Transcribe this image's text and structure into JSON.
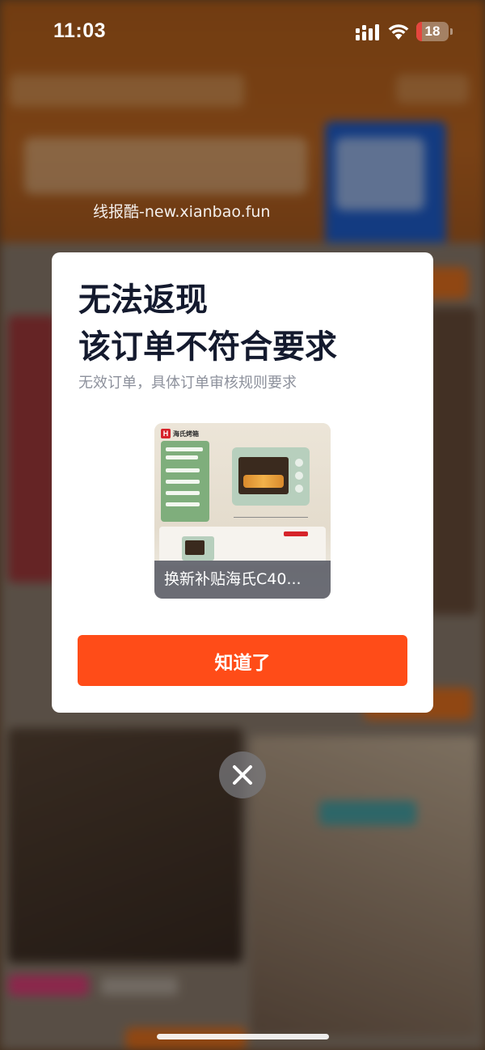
{
  "status_bar": {
    "time": "11:03",
    "battery": "18",
    "battery_level": 0.18,
    "signal_icon": "cellular-signal-icon",
    "wifi_icon": "wifi-icon",
    "battery_icon": "battery-icon"
  },
  "watermark": "线报酷-new.xianbao.fun",
  "dialog": {
    "title_line1": "无法返现",
    "title_line2": "该订单不符合要求",
    "subtitle": "无效订单，具体订单审核规则要求",
    "product": {
      "caption": "换新补贴海氏C40..."
    },
    "confirm_label": "知道了"
  },
  "close_icon": "close-icon",
  "colors": {
    "accent": "#ff4c18",
    "title": "#141a2e",
    "subtitle": "#8d919c"
  }
}
